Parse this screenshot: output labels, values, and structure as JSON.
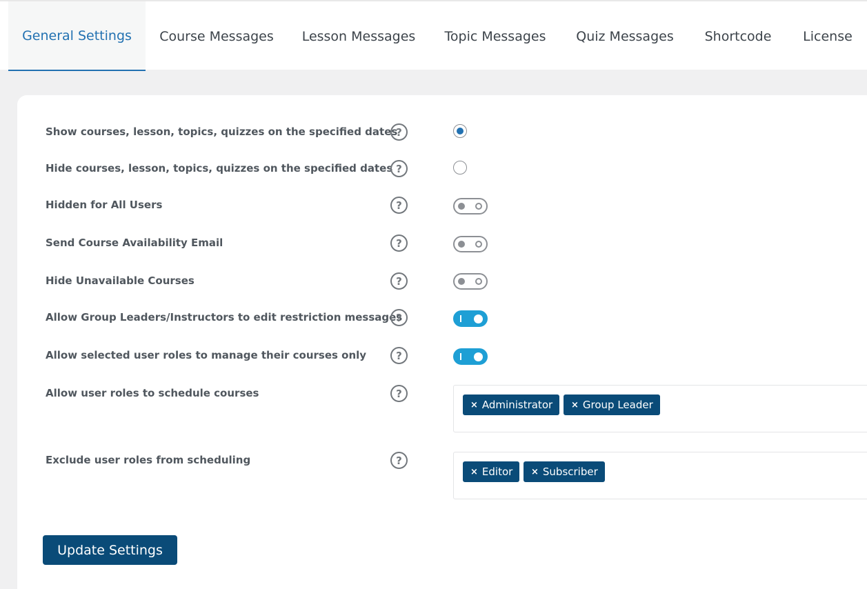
{
  "tabs": [
    {
      "label": "General Settings"
    },
    {
      "label": "Course Messages"
    },
    {
      "label": "Lesson Messages"
    },
    {
      "label": "Topic Messages"
    },
    {
      "label": "Quiz Messages"
    },
    {
      "label": "Shortcode"
    },
    {
      "label": "License"
    }
  ],
  "settings": {
    "show_dates": {
      "label": "Show courses, lesson, topics, quizzes on the specified dates",
      "checked": true
    },
    "hide_dates": {
      "label": "Hide courses, lesson, topics, quizzes on the specified dates",
      "checked": false
    },
    "hidden_all": {
      "label": "Hidden for All Users",
      "enabled": false
    },
    "send_email": {
      "label": "Send Course Availability Email",
      "enabled": false
    },
    "hide_unavailable": {
      "label": "Hide Unavailable Courses",
      "enabled": false
    },
    "allow_group_leaders": {
      "label": "Allow Group Leaders/Instructors to edit restriction messages",
      "enabled": true
    },
    "allow_manage_own": {
      "label": "Allow selected user roles to manage their courses only",
      "enabled": true
    },
    "schedule_roles": {
      "label": "Allow user roles to schedule courses",
      "chips": [
        "Administrator",
        "Group Leader"
      ]
    },
    "exclude_roles": {
      "label": "Exclude user roles from scheduling",
      "chips": [
        "Editor",
        "Subscriber"
      ]
    }
  },
  "help_glyph": "?",
  "chip_remove_glyph": "×",
  "update_button": "Update Settings",
  "colors": {
    "accent": "#2271b1",
    "toggle_on": "#1e9fd5",
    "chip": "#0a4b78"
  }
}
